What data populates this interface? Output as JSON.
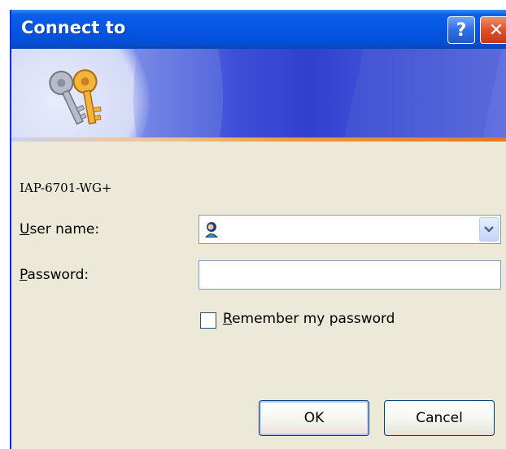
{
  "window": {
    "title": "Connect to",
    "help_glyph": "?",
    "close_glyph": "✕"
  },
  "server": "IAP-6701-WG+",
  "username": {
    "label_accel": "U",
    "label_rest": "ser name:",
    "value": ""
  },
  "password": {
    "label_accel": "P",
    "label_rest": "assword:",
    "value": ""
  },
  "remember": {
    "label_accel": "R",
    "label_rest": "emember my password",
    "checked": false
  },
  "buttons": {
    "ok": "OK",
    "cancel": "Cancel"
  },
  "icons": {
    "banner": "keys-icon",
    "username_field": "user-avatar-icon",
    "dropdown": "chevron-down-icon"
  },
  "colors": {
    "titlebar": "#0656e3",
    "dialog_bg": "#ece9d8",
    "input_border": "#7f9db9",
    "close_button": "#e0502a"
  }
}
